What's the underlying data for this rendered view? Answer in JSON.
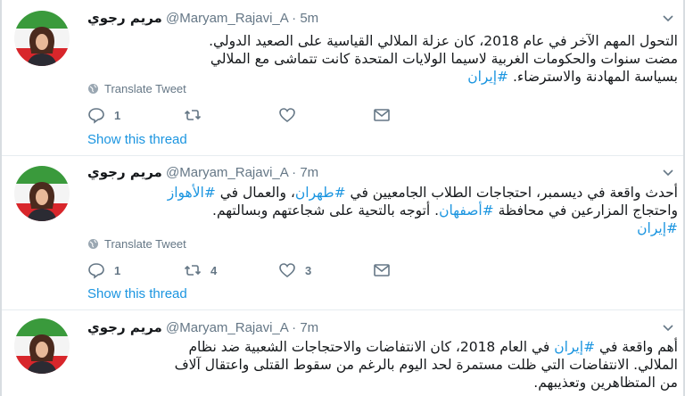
{
  "tweets": [
    {
      "name": "مريم رجوي",
      "handle": "@Maryam_Rajavi_A",
      "time": "5m",
      "lines": [
        [
          {
            "t": "التحول المهم الآخر في عام 2018، كان عزلة الملالي القياسية على الصعيد الدولي."
          }
        ],
        [
          {
            "t": "مضت سنوات والحكومات الغربية لاسيما الولايات المتحدة كانت تتماشى مع الملالي"
          }
        ],
        [
          {
            "t": "بسياسة المهادنة والاسترضاء. "
          },
          {
            "t": "#إيران",
            "tag": true
          }
        ]
      ],
      "translate": "Translate Tweet",
      "reply_count": "1",
      "retweet_count": "",
      "like_count": "",
      "thread": "Show this thread"
    },
    {
      "name": "مريم رجوي",
      "handle": "@Maryam_Rajavi_A",
      "time": "7m",
      "lines": [
        [
          {
            "t": "أحدث واقعة في ديسمبر، احتجاجات الطلاب الجامعيين في "
          },
          {
            "t": "#طهران",
            "tag": true
          },
          {
            "t": "، والعمال في "
          },
          {
            "t": "#الأهواز",
            "tag": true
          }
        ],
        [
          {
            "t": "واحتجاج المزارعين في محافظة "
          },
          {
            "t": "#أصفهان",
            "tag": true
          },
          {
            "t": ". أتوجه بالتحية على شجاعتهم وبسالتهم."
          }
        ],
        [
          {
            "t": "#إيران",
            "tag": true
          }
        ]
      ],
      "translate": "Translate Tweet",
      "reply_count": "1",
      "retweet_count": "4",
      "like_count": "3",
      "thread": "Show this thread"
    },
    {
      "name": "مريم رجوي",
      "handle": "@Maryam_Rajavi_A",
      "time": "7m",
      "lines": [
        [
          {
            "t": "أهم واقعة في "
          },
          {
            "t": "#إيران",
            "tag": true
          },
          {
            "t": " في العام 2018، كان الانتفاضات والاحتجاجات الشعبية ضد نظام"
          }
        ],
        [
          {
            "t": "الملالي. الانتفاضات التي ظلت مستمرة لحد اليوم بالرغم من سقوط القتلى واعتقال آلاف"
          }
        ],
        [
          {
            "t": "من المتظاهرين وتعذيبهم."
          }
        ]
      ]
    }
  ],
  "colors": {
    "link": "#1b95e0",
    "muted": "#657786",
    "text": "#14171a",
    "divider": "#e6ecf0"
  },
  "icons": [
    "caret-down-icon",
    "globe-icon",
    "reply-icon",
    "retweet-icon",
    "heart-icon",
    "message-icon"
  ]
}
